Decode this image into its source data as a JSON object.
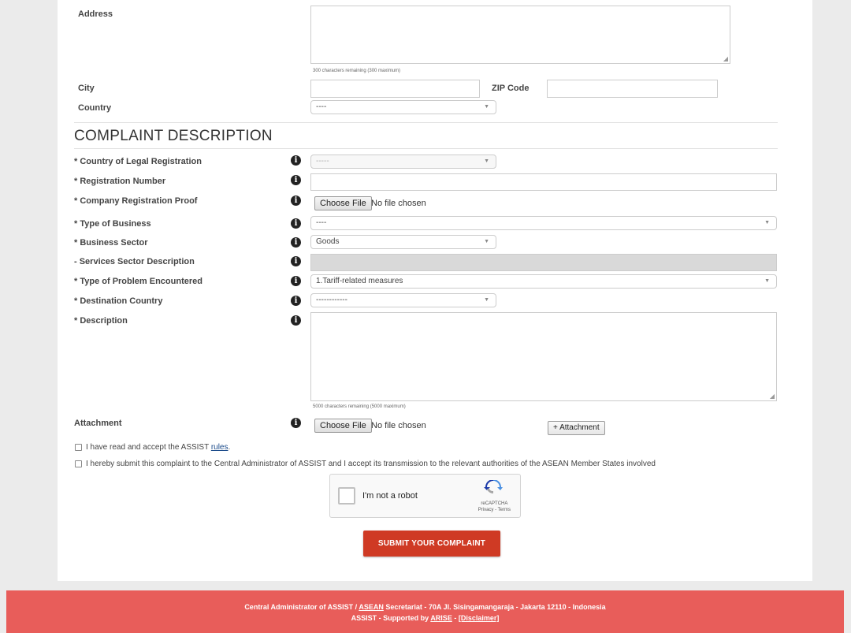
{
  "contact": {
    "address_label": "Address",
    "address_hint": "300 characters remaining (300 maximum)",
    "city_label": "City",
    "zip_label": "ZIP Code",
    "country_label": "Country",
    "country_value": "----"
  },
  "section": {
    "title": "COMPLAINT DESCRIPTION"
  },
  "fields": {
    "country_legal_label": "* Country of Legal Registration",
    "country_legal_value": "-----",
    "registration_number_label": "* Registration Number",
    "company_proof_label": "* Company Registration Proof",
    "type_business_label": "* Type of Business",
    "type_business_value": "----",
    "business_sector_label": "* Business Sector",
    "business_sector_value": "Goods",
    "services_sector_label": "- Services Sector Description",
    "problem_type_label": "* Type of Problem Encountered",
    "problem_type_value": "1.Tariff-related measures",
    "destination_label": "* Destination Country",
    "destination_value": "------------",
    "description_label": "* Description",
    "description_hint": "5000 characters remaining (5000 maximum)",
    "attachment_label": "Attachment",
    "add_attachment": "+ Attachment"
  },
  "file_input": {
    "button": "Choose File",
    "status": "No file chosen"
  },
  "consent": {
    "rules_text": "I have read and accept the ASSIST",
    "rules_link": "rules",
    "rules_end": ".",
    "submit_text": "I hereby submit this complaint to the Central Administrator of ASSIST and I accept its transmission to the relevant authorities of the ASEAN Member States involved"
  },
  "captcha": {
    "label": "I'm not a robot",
    "brand": "reCAPTCHA",
    "links": "Privacy - Terms"
  },
  "submit": {
    "label": "SUBMIT YOUR COMPLAINT"
  },
  "footer": {
    "line1_a": "Central Administrator of ASSIST /",
    "line1_link": "ASEAN",
    "line1_b": "Secretariat - 70A Jl. Sisingamangaraja - Jakarta 12110 - Indonesia",
    "line2_a": "ASSIST",
    "line2_b": "- Supported by",
    "line2_link1": "ARISE",
    "line2_sep": "-",
    "line2_link2": "[Disclaimer]"
  },
  "icons": {
    "info": "info-icon",
    "caret": "chevron-down-icon",
    "recaptcha": "recaptcha-logo-icon"
  },
  "colors": {
    "submit_bg": "#cf3a24",
    "footer_bg": "#e85d5a",
    "page_bg": "#ebebeb"
  }
}
